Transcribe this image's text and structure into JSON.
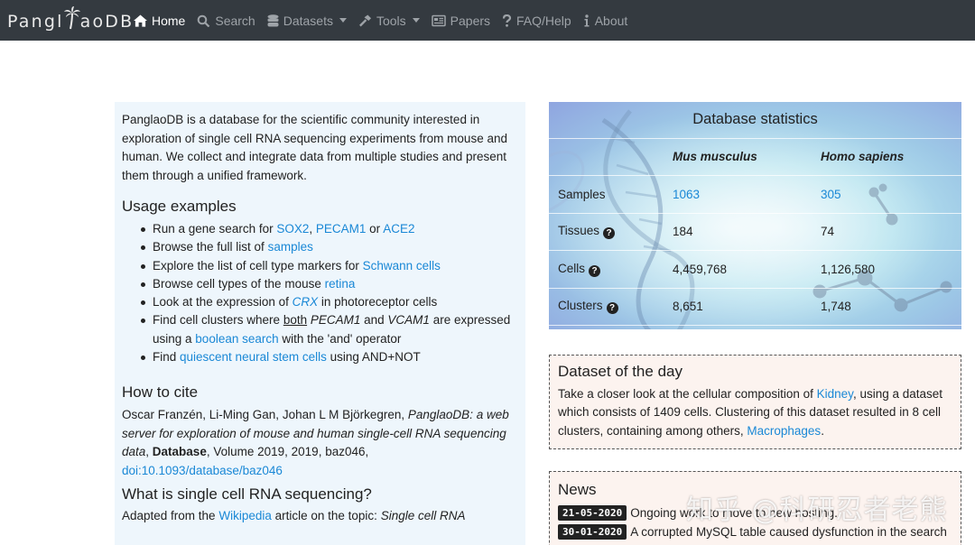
{
  "brand": {
    "name_pre": "Pangl",
    "name_post": "aoDB"
  },
  "nav": [
    {
      "label": "Home",
      "icon": "home-icon",
      "active": true
    },
    {
      "label": "Search",
      "icon": "search-icon"
    },
    {
      "label": "Datasets",
      "icon": "database-icon",
      "dropdown": true
    },
    {
      "label": "Tools",
      "icon": "hammer-icon",
      "dropdown": true
    },
    {
      "label": "Papers",
      "icon": "newspaper-icon"
    },
    {
      "label": "FAQ/Help",
      "icon": "question-icon"
    },
    {
      "label": "About",
      "icon": "info-icon"
    }
  ],
  "intro": "PanglaoDB is a database for the scientific community interested in exploration of single cell RNA sequencing experiments from mouse and human. We collect and integrate data from multiple studies and present them through a unified framework.",
  "usage": {
    "title": "Usage examples",
    "items": {
      "i1": {
        "pre": "Run a gene search for ",
        "l1": "SOX2",
        "s1": ", ",
        "l2": "PECAM1",
        "s2": " or ",
        "l3": "ACE2"
      },
      "i2": {
        "pre": "Browse the full list of ",
        "link": "samples"
      },
      "i3": {
        "pre": "Explore the list of cell type markers for ",
        "link": "Schwann cells"
      },
      "i4": {
        "pre": "Browse cell types of the mouse ",
        "link": "retina"
      },
      "i5": {
        "pre": "Look at the expression of ",
        "link": "CRX",
        "post": " in photoreceptor cells"
      },
      "i6": {
        "pre": "Find cell clusters where ",
        "u": "both",
        "sp1": " ",
        "g1": "PECAM1",
        "mid": " and ",
        "g2": "VCAM1",
        "post": " are expressed using a ",
        "link": "boolean search",
        "post2": " with the 'and' operator"
      },
      "i7": {
        "pre": "Find ",
        "link": "quiescent neural stem cells",
        "post": " using AND+NOT"
      }
    }
  },
  "cite": {
    "title": "How to cite",
    "authors": "Oscar Franzén, Li-Ming Gan, Johan L M Björkegren, ",
    "paper": "PanglaoDB: a web server for exploration of mouse and human single-cell RNA sequencing data",
    "sep": ", ",
    "journal": "Database",
    "details": ", Volume 2019, 2019, baz046, ",
    "doi": "doi:10.1093/database/baz046"
  },
  "what": {
    "title": "What is single cell RNA sequencing?",
    "pre": "Adapted from the ",
    "link": "Wikipedia",
    "mid": " article on the topic: ",
    "topic": "Single cell RNA"
  },
  "stats": {
    "title": "Database statistics",
    "col1": "Mus musculus",
    "col2": "Homo sapiens",
    "rows": [
      {
        "label": "Samples",
        "mouse": "1063",
        "human": "305",
        "help": false
      },
      {
        "label": "Tissues",
        "mouse": "184",
        "human": "74",
        "help": true
      },
      {
        "label": "Cells",
        "mouse": "4,459,768",
        "human": "1,126,580",
        "help": true
      },
      {
        "label": "Clusters",
        "mouse": "8,651",
        "human": "1,748",
        "help": true
      }
    ]
  },
  "dotd": {
    "title": "Dataset of the day",
    "pre": "Take a closer look at the cellular composition of ",
    "link1": "Kidney",
    "mid": ", using a dataset which consists of 1409 cells. Clustering of this dataset resulted in 8 cell clusters, containing among others, ",
    "link2": "Macrophages",
    "post": "."
  },
  "news": {
    "title": "News",
    "items": [
      {
        "date": "21-05-2020",
        "text": "Ongoing work to move to new hosting."
      },
      {
        "date": "30-01-2020",
        "text": "A corrupted MySQL table caused dysfunction in the search"
      }
    ]
  },
  "watermark": "知乎 @科研忍者老熊",
  "colors": {
    "navbar": "#343a40",
    "link": "#1a88d6",
    "left_panel": "#eef6fc",
    "card_bg": "#fcf3ef"
  }
}
